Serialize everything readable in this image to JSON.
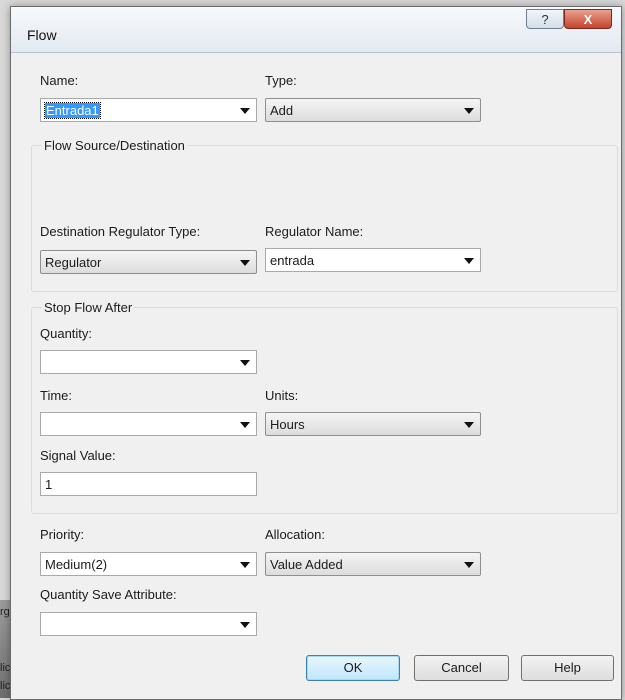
{
  "window": {
    "title": "Flow",
    "help_glyph": "?",
    "close_glyph": "X"
  },
  "background": {
    "fragments": [
      "rg",
      "lic",
      "lic"
    ]
  },
  "name": {
    "label": "Name:",
    "value": "Entrada1"
  },
  "type": {
    "label": "Type:",
    "value": "Add"
  },
  "flow_source": {
    "legend": "Flow Source/Destination",
    "dest_regulator_type": {
      "label": "Destination Regulator Type:",
      "value": "Regulator"
    },
    "regulator_name": {
      "label": "Regulator Name:",
      "value": "entrada"
    }
  },
  "stop_flow": {
    "legend": "Stop Flow After",
    "quantity": {
      "label": "Quantity:",
      "value": ""
    },
    "time": {
      "label": "Time:",
      "value": ""
    },
    "units": {
      "label": "Units:",
      "value": "Hours"
    },
    "signal_value": {
      "label": "Signal Value:",
      "value": "1"
    }
  },
  "priority": {
    "label": "Priority:",
    "value": "Medium(2)"
  },
  "allocation": {
    "label": "Allocation:",
    "value": "Value Added"
  },
  "quantity_save_attribute": {
    "label": "Quantity Save Attribute:",
    "value": ""
  },
  "buttons": {
    "ok": "OK",
    "cancel": "Cancel",
    "help": "Help"
  }
}
